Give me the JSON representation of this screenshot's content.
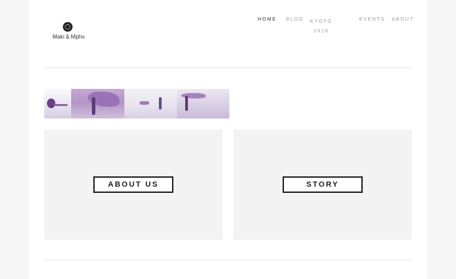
{
  "site": {
    "logo_text": "Maki & Mpho",
    "logo_icon": "circular-seal-icon"
  },
  "nav": {
    "items": [
      {
        "label": "HOME",
        "active": true
      },
      {
        "label": "BLOG",
        "active": false
      },
      {
        "label": "KYOTO",
        "sublabel": "2016",
        "active": false
      },
      {
        "label": "EVENTS",
        "active": false
      },
      {
        "label": "ABOUT",
        "active": false
      }
    ]
  },
  "banner": {
    "image": "beach-photo-strip-purple-tint"
  },
  "cards": [
    {
      "button_label": "ABOUT US"
    },
    {
      "button_label": "STORY"
    }
  ],
  "colors": {
    "background": "#ffffff",
    "card": "#f3f3f3",
    "text_dark": "#222222",
    "nav_inactive": "#9a9a9a",
    "banner_tint": "#b394c6"
  }
}
